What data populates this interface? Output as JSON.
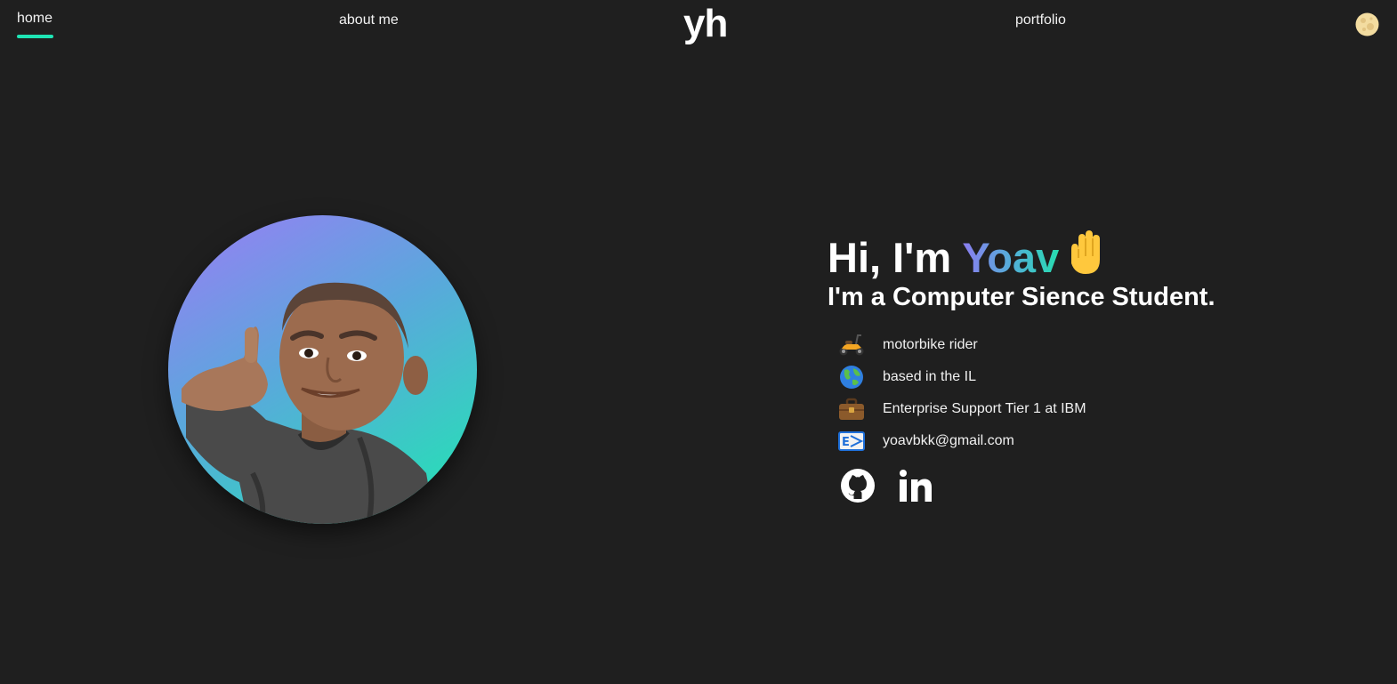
{
  "nav": {
    "home_label": "home",
    "about_label": "about me",
    "logo_text": "yh",
    "portfolio_label": "portfolio",
    "theme_toggle_icon": "moon-icon",
    "accent_color": "#1ee4b4"
  },
  "hero": {
    "greeting_prefix": "Hi, I'm ",
    "name": "Yoav",
    "wave_icon": "raised-hand-icon",
    "subtitle": "I'm a Computer Sience Student.",
    "avatar_icon": "memoji-avatar"
  },
  "facts": [
    {
      "icon": "scooter-icon",
      "text": "motorbike rider"
    },
    {
      "icon": "globe-icon",
      "text": "based in the IL"
    },
    {
      "icon": "briefcase-icon",
      "text": "Enterprise Support Tier 1 at IBM"
    },
    {
      "icon": "email-icon",
      "text": "yoavbkk@gmail.com"
    }
  ],
  "social": [
    {
      "icon": "github-icon"
    },
    {
      "icon": "linkedin-icon"
    }
  ],
  "colors": {
    "background": "#1f1f1f",
    "gradient_start": "#9b7cf5",
    "gradient_end": "#1ee8b0"
  }
}
